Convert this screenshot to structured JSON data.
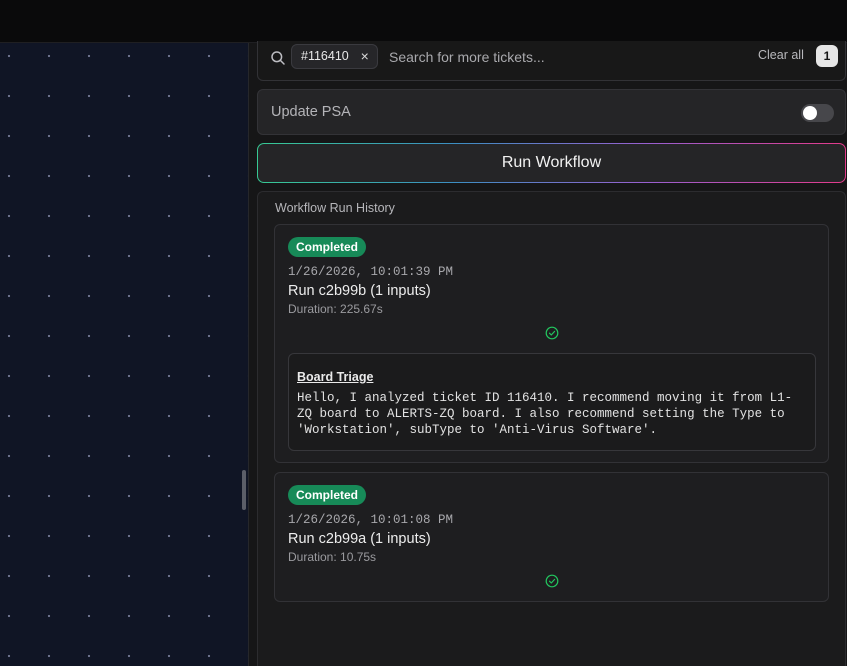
{
  "search": {
    "chip_label": "#116410",
    "chip_remove_glyph": "×",
    "placeholder": "Search for more tickets...",
    "value": "",
    "clear_label": "Clear all",
    "count": "1",
    "icon": "search-icon"
  },
  "psa": {
    "label": "Update PSA",
    "enabled": false
  },
  "run_button": {
    "label": "Run Workflow"
  },
  "history": {
    "title": "Workflow Run History",
    "runs": [
      {
        "status": "Completed",
        "timestamp": "1/26/2026, 10:01:39 PM",
        "name": "Run c2b99b (1 inputs)",
        "duration": "Duration: 225.67s",
        "step": {
          "title": "Board Triage",
          "text": "Hello, I analyzed ticket ID 116410. I recommend moving it from L1-ZQ board to ALERTS-ZQ board. I also recommend setting the Type to 'Workstation', subType to 'Anti-Virus Software'."
        }
      },
      {
        "status": "Completed",
        "timestamp": "1/26/2026, 10:01:08 PM",
        "name": "Run c2b99a (1 inputs)",
        "duration": "Duration: 10.75s"
      }
    ]
  },
  "colors": {
    "status_completed": "#178a58",
    "check_green": "#22c55e",
    "canvas_background": "#101525"
  }
}
